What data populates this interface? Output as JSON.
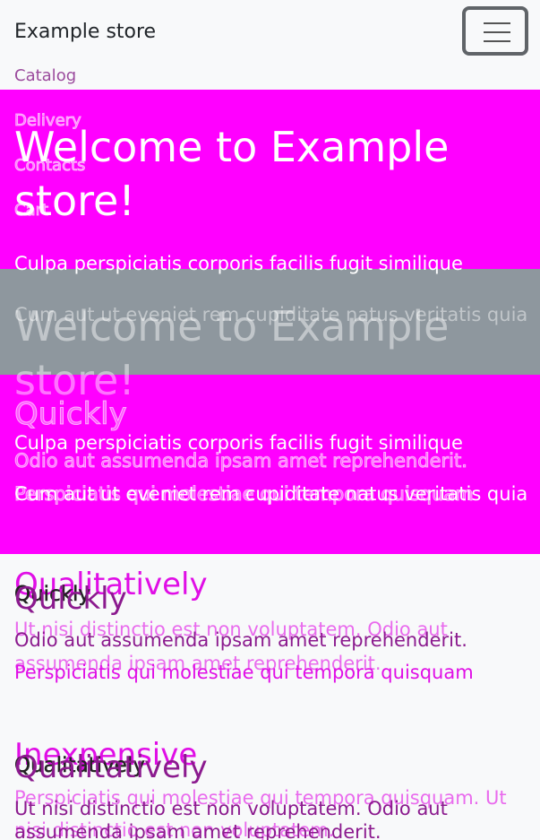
{
  "navbar": {
    "brand": "Example store",
    "links": [
      "Catalog",
      "Delivery",
      "Contacts",
      "Cart"
    ]
  },
  "hero": {
    "heading": "Welcome to Example store!",
    "lead_line1": "Culpa perspiciatis corporis facilis fugit similique",
    "lead_line2": "Cum aut ut eveniet rem cupiditate natus veritatis quia"
  },
  "features": [
    {
      "title": "Quickly",
      "text": "Odio aut assumenda ipsam amet reprehenderit.",
      "text2": "Perspiciatis qui molestiae qui tempora quisquam"
    },
    {
      "title": "Qualitatively",
      "text": "Ut nisi distinctio est non voluptatem. Odio aut",
      "text2": "assumenda ipsam amet reprehenderit."
    },
    {
      "title": "Inexpensive",
      "text": "Perspiciatis qui molestiae qui tempora quisquam. Ut",
      "text2": "nisi distinctio est non voluptatem."
    }
  ],
  "colors": {
    "hero_bg": "#ff00ff",
    "band_bg": "#8e979e",
    "link": "#9b4b9d",
    "page_bg": "#f8f9fa"
  },
  "icons": {
    "menu": "hamburger-menu-icon"
  }
}
